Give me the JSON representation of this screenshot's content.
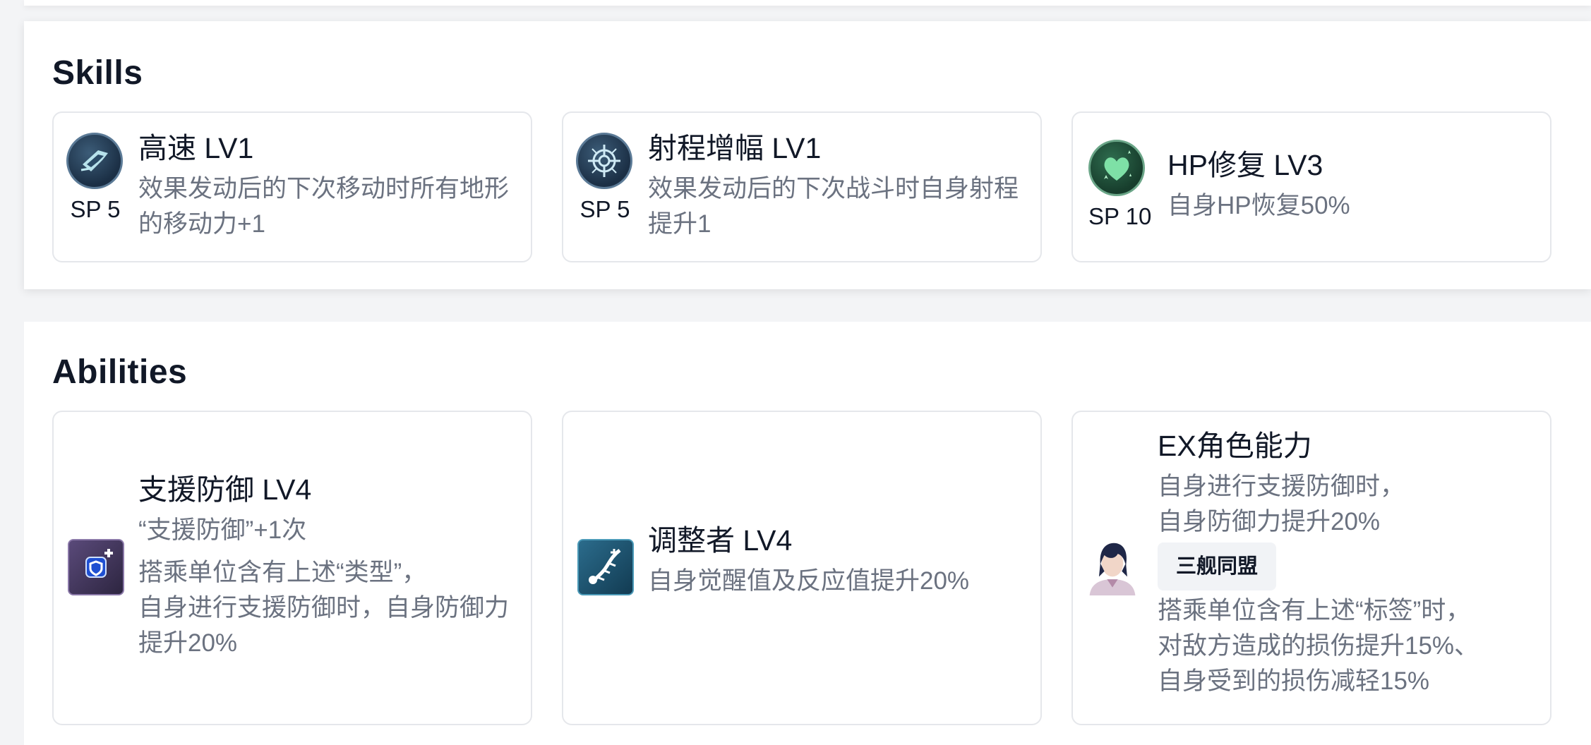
{
  "skills": {
    "title": "Skills",
    "cards": [
      {
        "name": "高速 LV1",
        "sp": "SP 5",
        "icon": "speed-arrow-icon",
        "desc": [
          "效果发动后的下次移动时所有地形",
          "的移动力+1"
        ]
      },
      {
        "name": "射程增幅 LV1",
        "sp": "SP 5",
        "icon": "crosshair-target-icon",
        "desc": [
          "效果发动后的下次战斗时自身射程",
          "提升1"
        ]
      },
      {
        "name": "HP修复 LV3",
        "sp": "SP 10",
        "icon": "heart-heal-icon",
        "desc": [
          "自身HP恢复50%"
        ]
      }
    ]
  },
  "abilities": {
    "title": "Abilities",
    "cards": [
      {
        "name": "支援防御 LV4",
        "icon": "shield-plus-icon",
        "desc": [
          "“支援防御”+1次",
          "搭乘单位含有上述“类型”，",
          "自身进行支援防御时，自身防御力",
          "提升20%"
        ]
      },
      {
        "name": "调整者 LV4",
        "icon": "coordinator-dna-icon",
        "desc": [
          "自身觉醒值及反应值提升20%"
        ]
      },
      {
        "name": "EX角色能力",
        "icon": "pilot-avatar-icon",
        "desc_top": [
          "自身进行支援防御时，",
          "自身防御力提升20%"
        ],
        "tag": "三舰同盟",
        "desc_bottom": [
          "搭乘单位含有上述“标签”时，",
          "对敌方造成的损伤提升15%、",
          "自身受到的损伤减轻15%"
        ]
      }
    ]
  }
}
